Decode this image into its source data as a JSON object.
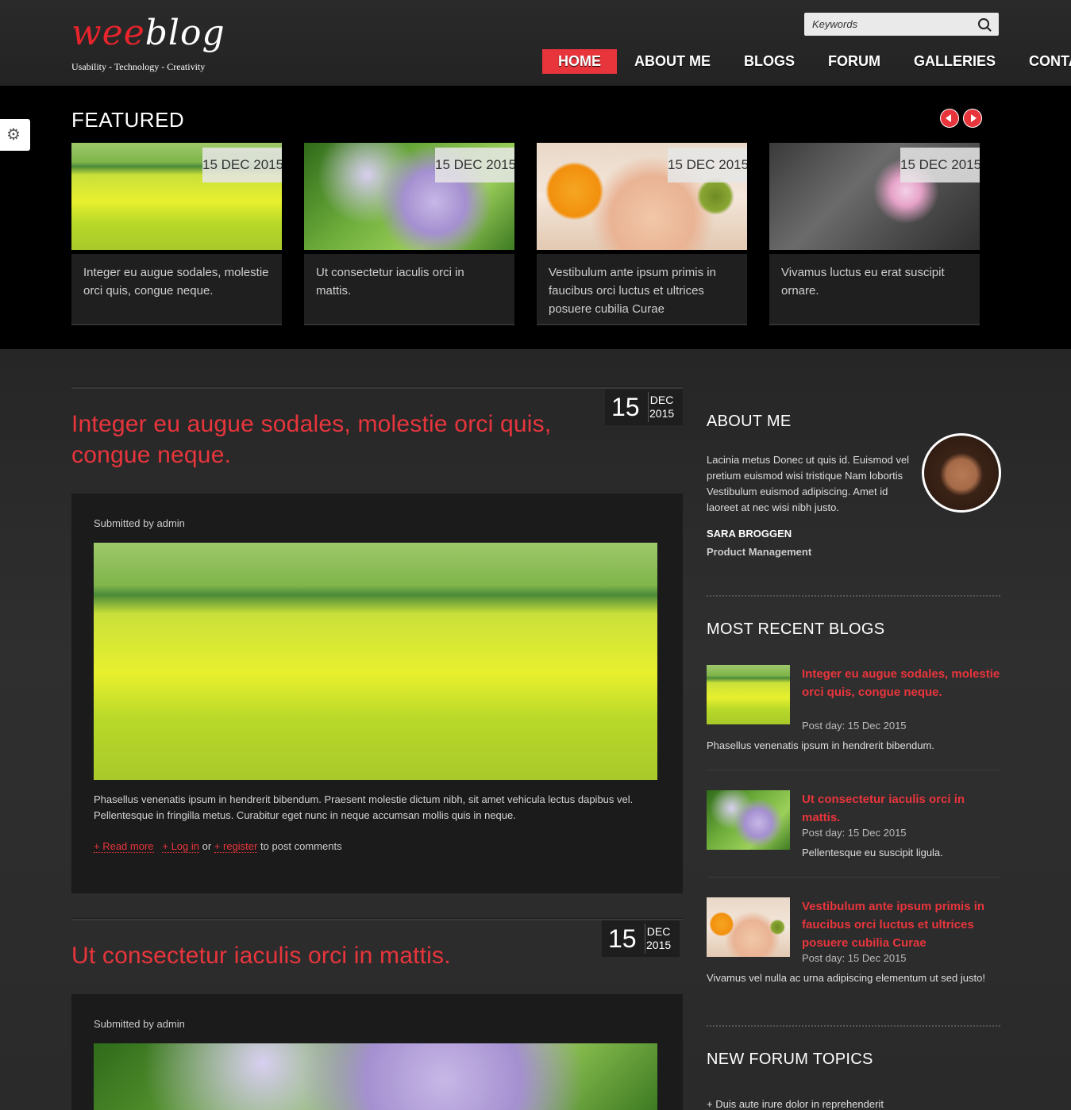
{
  "brand": {
    "logo_part1": "wee",
    "logo_part2": "blog",
    "tagline": "Usability - Technology - Creativity",
    "accent": "#e8353c"
  },
  "search": {
    "placeholder": "Keywords"
  },
  "nav": [
    {
      "label": "HOME",
      "active": true
    },
    {
      "label": "ABOUT ME"
    },
    {
      "label": "BLOGS"
    },
    {
      "label": "FORUM"
    },
    {
      "label": "GALLERIES"
    },
    {
      "label": "CONTACT"
    }
  ],
  "featured": {
    "title": "FEATURED",
    "items": [
      {
        "date": "15 DEC 2015",
        "text": "Integer eu augue sodales, molestie orci quis, congue neque."
      },
      {
        "date": "15 DEC 2015",
        "text": "Ut consectetur iaculis orci in mattis."
      },
      {
        "date": "15 DEC 2015",
        "text": "Vestibulum ante ipsum primis in faucibus orci luctus et ultrices posuere cubilia Curae"
      },
      {
        "date": "15 DEC 2015",
        "text": "Vivamus luctus eu erat suscipit ornare."
      }
    ]
  },
  "posts": [
    {
      "title": "Integer eu augue sodales, molestie orci quis, congue neque.",
      "day": "15",
      "month": "DEC",
      "year": "2015",
      "submitted": "Submitted by admin",
      "body": "Phasellus venenatis ipsum in hendrerit bibendum. Praesent molestie dictum nibh, sit amet vehicula lectus dapibus vel. Pellentesque in fringilla metus. Curabitur eget nunc in neque accumsan mollis quis in neque.",
      "read_more": "+ Read more",
      "login": "+ Log in",
      "or": "or",
      "register": "+ register",
      "post_comments": "to post comments"
    },
    {
      "title": "Ut consectetur iaculis orci in mattis.",
      "day": "15",
      "month": "DEC",
      "year": "2015",
      "submitted": "Submitted by admin"
    }
  ],
  "sidebar": {
    "about": {
      "heading": "ABOUT ME",
      "text": "Lacinia metus Donec ut quis id. Euismod vel pretium euismod wisi tristique Nam lobortis Vestibulum euismod adipiscing. Amet id laoreet at nec wisi nibh justo.",
      "name": "SARA BROGGEN",
      "role": "Product Management"
    },
    "recent": {
      "heading": "MOST RECENT BLOGS",
      "items": [
        {
          "title": "Integer eu augue sodales, molestie orci quis, congue neque.",
          "date": "Post day: 15 Dec 2015",
          "excerpt": "Phasellus venenatis ipsum in hendrerit bibendum."
        },
        {
          "title": "Ut consectetur iaculis orci in mattis.",
          "date": "Post day: 15 Dec 2015",
          "excerpt": "Pellentesque eu suscipit ligula."
        },
        {
          "title": "Vestibulum ante ipsum primis in faucibus orci luctus et ultrices posuere cubilia Curae",
          "date": "Post day: 15 Dec 2015",
          "excerpt": "Vivamus vel nulla ac urna adipiscing elementum ut sed justo!"
        }
      ]
    },
    "forum": {
      "heading": "NEW FORUM TOPICS",
      "items": [
        "+ Duis aute irure dolor in reprehenderit"
      ]
    }
  },
  "icons": {
    "settings": "gear-icon",
    "search": "search-icon",
    "prev": "arrow-left-icon",
    "next": "arrow-right-icon"
  }
}
